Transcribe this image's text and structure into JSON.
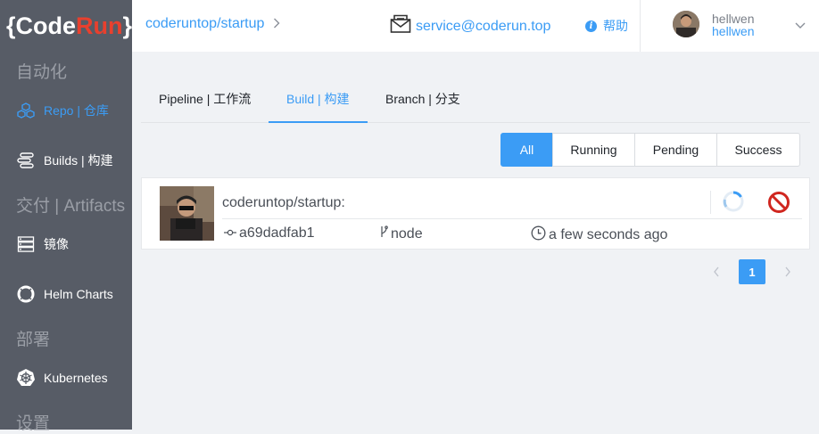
{
  "logo": {
    "open": "{",
    "code": "Code",
    "run": "Run",
    "close": "}"
  },
  "sidebar": {
    "sections": [
      "自动化",
      "交付 | Artifacts",
      "部署",
      "设置"
    ],
    "items": [
      {
        "label": "Repo | 仓库",
        "icon": "cubes-icon",
        "active": true
      },
      {
        "label": "Builds | 构建",
        "icon": "pipeline-icon",
        "active": false
      },
      {
        "label": "镜像",
        "icon": "server-icon",
        "active": false
      },
      {
        "label": "Helm Charts",
        "icon": "lifebuoy-icon",
        "active": false
      },
      {
        "label": "Kubernetes",
        "icon": "helm-wheel-icon",
        "active": false
      }
    ]
  },
  "header": {
    "breadcrumb": "coderuntop/startup",
    "email": "service@coderun.top",
    "help": "帮助",
    "user_name": "hellwen",
    "user_login": "hellwen"
  },
  "tabs": [
    "Pipeline | 工作流",
    "Build | 构建",
    "Branch | 分支"
  ],
  "active_tab": 1,
  "filters": [
    "All",
    "Running",
    "Pending",
    "Success"
  ],
  "active_filter": 0,
  "build": {
    "title": "coderuntop/startup:",
    "commit": "a69dadfab1",
    "branch": "node",
    "time": "a few seconds ago"
  },
  "pagination": {
    "prev": "‹",
    "current": "1",
    "next": "›"
  },
  "colors": {
    "accent": "#3b9cf5",
    "sidebar": "#575c66",
    "brand_red": "#e8402e",
    "cancel": "#d0261f"
  }
}
